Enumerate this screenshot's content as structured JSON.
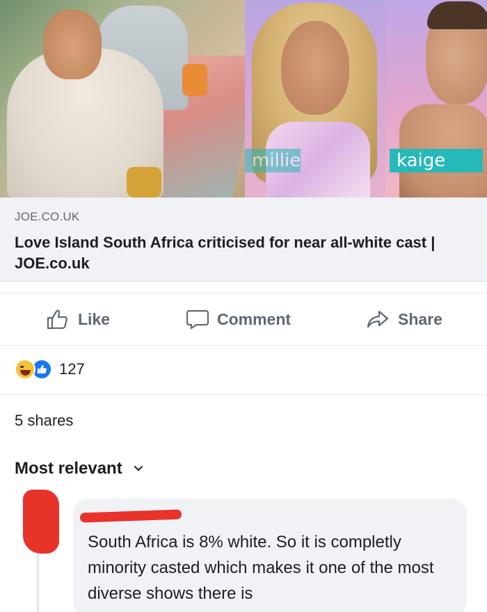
{
  "link_preview": {
    "image_labels": {
      "millie": "millie",
      "kaige": "kaige"
    },
    "source_domain": "JOE.CO.UK",
    "headline": "Love Island South Africa criticised for near all-white cast | JOE.co.uk"
  },
  "actions": {
    "like_label": "Like",
    "comment_label": "Comment",
    "share_label": "Share"
  },
  "reactions": {
    "types": [
      "haha",
      "like"
    ],
    "count": "127"
  },
  "shares_text": "5 shares",
  "comments": {
    "sort_label": "Most relevant",
    "items": [
      {
        "text": "South Africa is 8% white. So it is completly minority casted which makes it one of the most diverse shows there is"
      }
    ]
  },
  "colors": {
    "meta_background": "#f0f2f5",
    "like_blue": "#1877f2",
    "haha_yellow": "#f7c23a",
    "name_tag_teal": "#27b9b7",
    "redaction_red": "#e8332b"
  }
}
